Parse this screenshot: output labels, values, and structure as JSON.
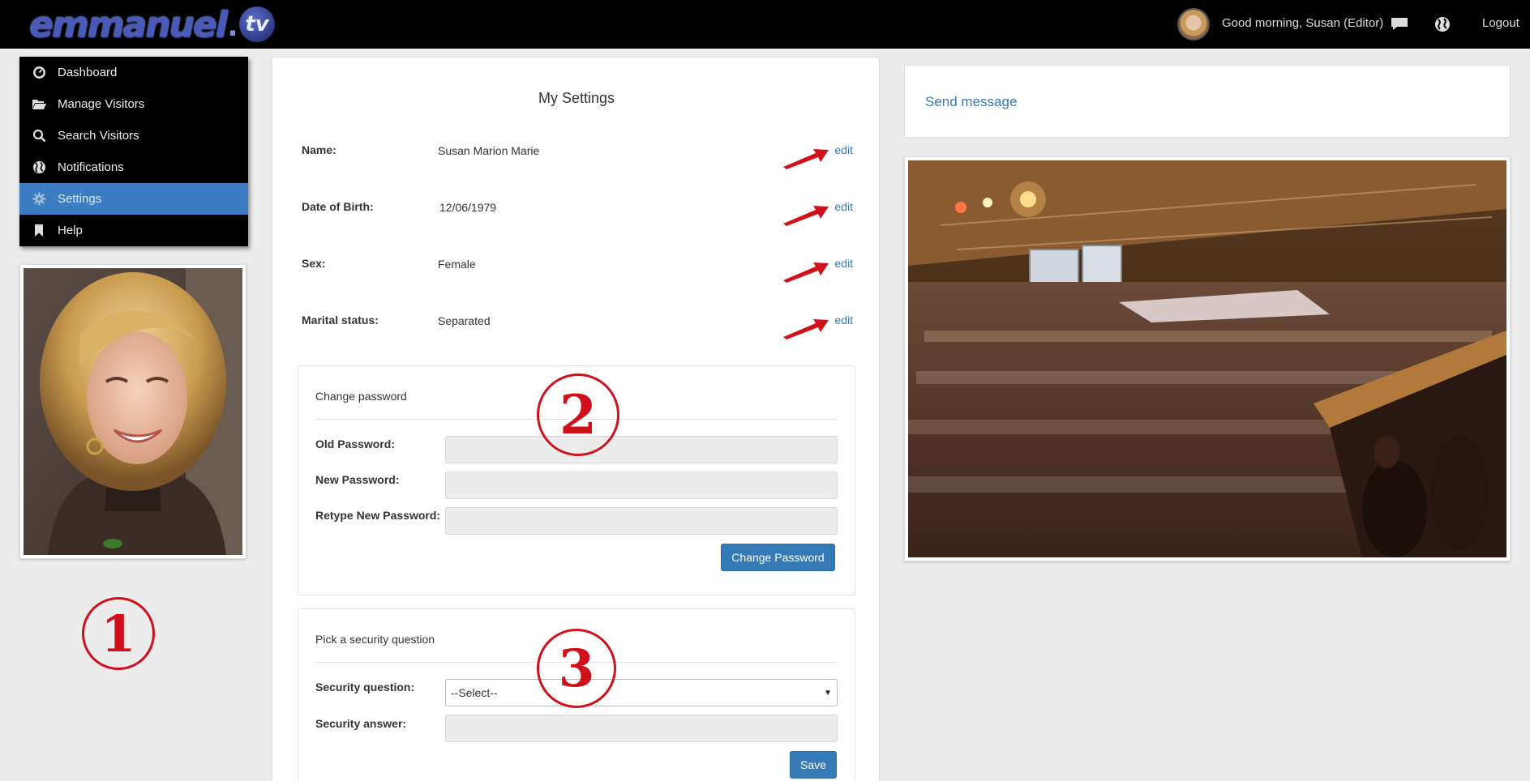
{
  "topbar": {
    "logo_main": "emmanuel",
    "logo_dot": ".",
    "logo_tv": "tv",
    "greeting": "Good morning, Susan (Editor)",
    "logout": "Logout"
  },
  "sidebar": {
    "items": [
      {
        "label": "Dashboard",
        "icon": "dashboard-icon",
        "active": false
      },
      {
        "label": "Manage Visitors",
        "icon": "folder-open-icon",
        "active": false
      },
      {
        "label": "Search Visitors",
        "icon": "search-icon",
        "active": false
      },
      {
        "label": "Notifications",
        "icon": "globe-icon",
        "active": false
      },
      {
        "label": "Settings",
        "icon": "gear-icon",
        "active": true
      },
      {
        "label": "Help",
        "icon": "bookmark-icon",
        "active": false
      }
    ]
  },
  "badges": {
    "one": "1",
    "two": "2",
    "three": "3"
  },
  "settings": {
    "title": "My Settings",
    "rows": [
      {
        "label": "Name:",
        "value": "Susan Marion Marie",
        "edit": "edit"
      },
      {
        "label": "Date of Birth:",
        "value": "12/06/1979",
        "edit": "edit"
      },
      {
        "label": "Sex:",
        "value": "Female",
        "edit": "edit"
      },
      {
        "label": "Marital status:",
        "value": "Separated",
        "edit": "edit"
      }
    ]
  },
  "password": {
    "title": "Change password",
    "old_label": "Old Password:",
    "new_label": "New Password:",
    "retype_label": "Retype New Password:",
    "button": "Change Password"
  },
  "security": {
    "title": "Pick a security question",
    "question_label": "Security question:",
    "question_selected": "--Select--",
    "answer_label": "Security answer:",
    "button": "Save"
  },
  "right": {
    "send_message": "Send message"
  },
  "colors": {
    "accent": "#337ab7",
    "active_nav": "#3c7ec1",
    "badge_red": "#d0111b",
    "topbar": "#000000"
  }
}
